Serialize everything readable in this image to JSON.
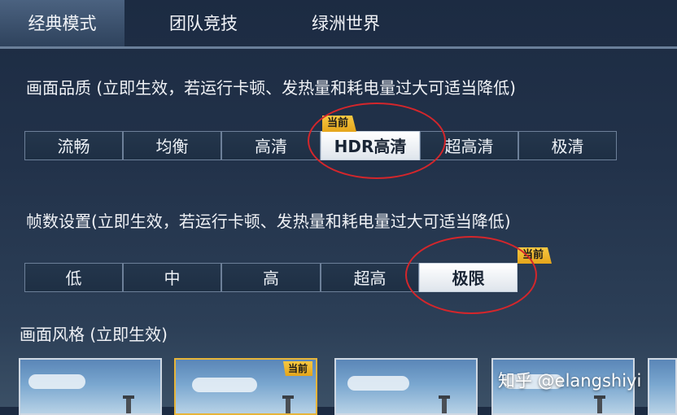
{
  "tabs": [
    {
      "label": "经典模式",
      "active": true
    },
    {
      "label": "团队竞技",
      "active": false
    },
    {
      "label": "绿洲世界",
      "active": false
    }
  ],
  "quality": {
    "label": "画面品质 (立即生效，若运行卡顿、发热量和耗电量过大可适当降低)",
    "options": [
      "流畅",
      "均衡",
      "高清",
      "HDR高清",
      "超高清",
      "极清"
    ],
    "selected": "HDR高清",
    "current_badge": "当前"
  },
  "framerate": {
    "label": "帧数设置(立即生效，若运行卡顿、发热量和耗电量过大可适当降低)",
    "options": [
      "低",
      "中",
      "高",
      "超高",
      "极限"
    ],
    "selected": "极限",
    "current_badge": "当前"
  },
  "style": {
    "label": "画面风格 (立即生效)",
    "current_badge": "当前",
    "selected_index": 1
  },
  "watermark": "知乎 @elangshiyi",
  "colors": {
    "highlight_circle": "#d4262b",
    "badge": "#f0b82e",
    "selected_segment": "#ffffff"
  }
}
